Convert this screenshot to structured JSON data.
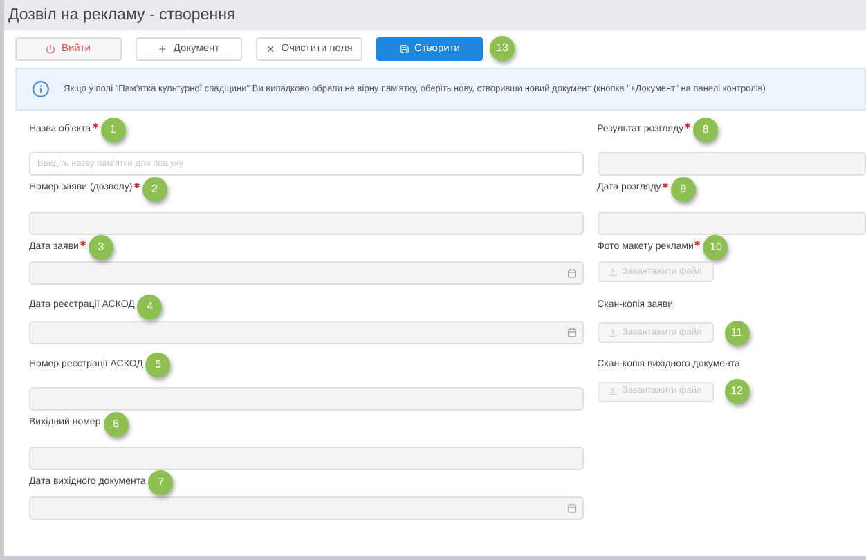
{
  "window": {
    "title": "Дозвіл на рекламу - створення"
  },
  "toolbar": {
    "buttons": [
      {
        "kind": "exit",
        "label": "Вийти"
      },
      {
        "kind": "add",
        "label": "Документ"
      },
      {
        "kind": "clear",
        "label": "Очистити поля"
      },
      {
        "kind": "create",
        "label": "Створити",
        "callout": "13"
      }
    ]
  },
  "info": {
    "text": "Якщо у полі \"Пам'ятка культурної спадщини\" Ви випадково обрали не вірну пам'ятку, оберіть нову, створивши новий документ (кнопка \"+Документ\" на панелі контролів)"
  },
  "left_fields": [
    {
      "kind": "text",
      "label": "Назва об'єкта",
      "required": true,
      "callout": "1",
      "placeholder": "Введіть назву пам'ятки для пошуку"
    },
    {
      "kind": "text",
      "label": "Номер заяви (дозволу)",
      "required": true,
      "callout": "2"
    },
    {
      "kind": "date",
      "label": "Дата заяви",
      "required": true,
      "callout": "3"
    },
    {
      "kind": "date",
      "label": "Дата реєстрації АСКОД",
      "required": false,
      "callout": "4"
    },
    {
      "kind": "text",
      "label": "Номер реєстрації АСКОД",
      "required": false,
      "callout": "5"
    },
    {
      "kind": "text",
      "label": "Вихідний номер",
      "required": false,
      "callout": "6"
    },
    {
      "kind": "date",
      "label": "Дата вихідного документа",
      "required": false,
      "callout": "7"
    }
  ],
  "right_fields": [
    {
      "kind": "text",
      "label": "Результат розгляду",
      "required": true,
      "callout": "8"
    },
    {
      "kind": "text",
      "label": "Дата розгляду",
      "required": true,
      "callout": "9"
    },
    {
      "kind": "upload",
      "label": "Фото макету реклами",
      "required": true,
      "callout": "10",
      "button": "Завантажити файл"
    },
    {
      "kind": "upload",
      "label": "Скан-копія заяви",
      "required": false,
      "callout_beside_button": "11",
      "button": "Завантажити файл"
    },
    {
      "kind": "upload",
      "label": "Скан-копія вихідного документа",
      "required": false,
      "callout_beside_button": "12",
      "button": "Завантажити файл"
    }
  ]
}
